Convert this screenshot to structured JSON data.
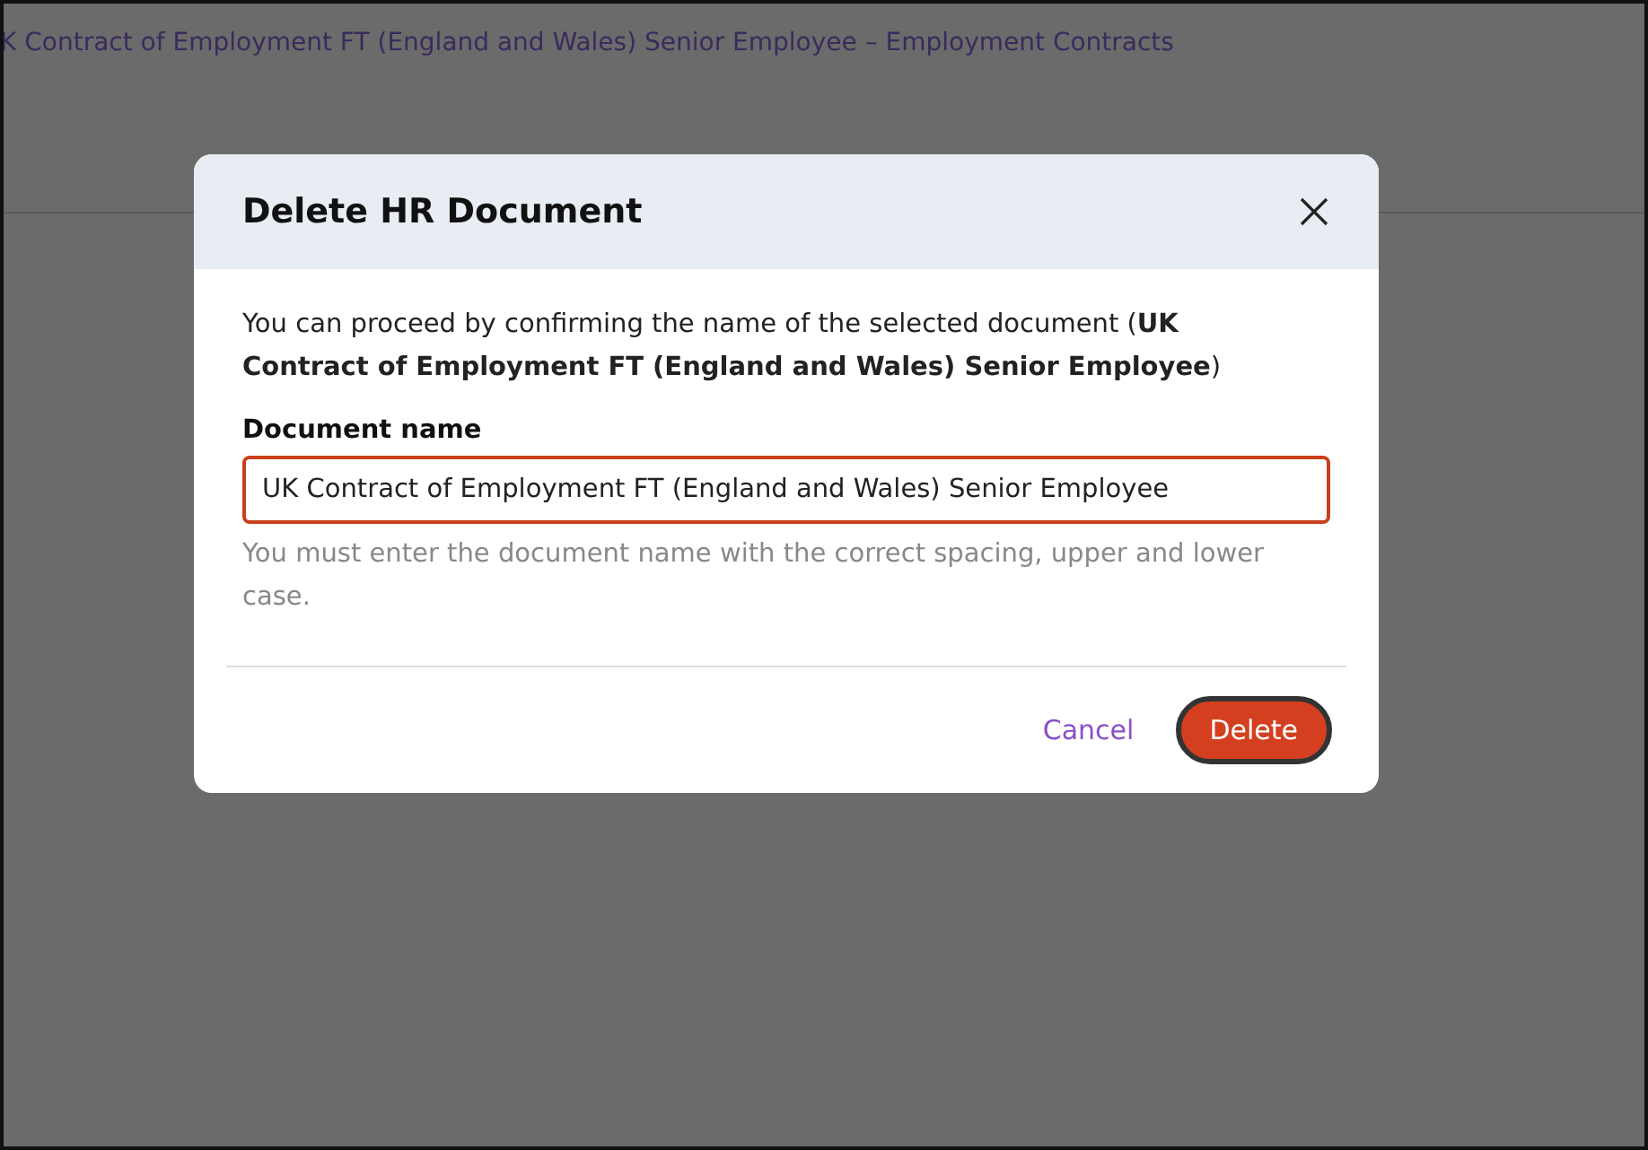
{
  "page": {
    "title": "K Contract of Employment FT (England and Wales) Senior Employee – Employment Contracts"
  },
  "dialog": {
    "title": "Delete HR Document",
    "intro": "You can proceed by confirming the name of the selected document (**UK Contract of Employment FT (England and Wales) Senior Employee**)",
    "field": {
      "label": "Document name",
      "value": "UK Contract of Employment FT (England and Wales) Senior Employee",
      "invalid": true,
      "hint": "You must enter the document name with the correct spacing, upper and lower case."
    },
    "buttons": [
      {
        "kind": "link",
        "label": "Cancel",
        "focused": false
      },
      {
        "kind": "danger",
        "label": "Delete",
        "focused": true
      }
    ]
  }
}
